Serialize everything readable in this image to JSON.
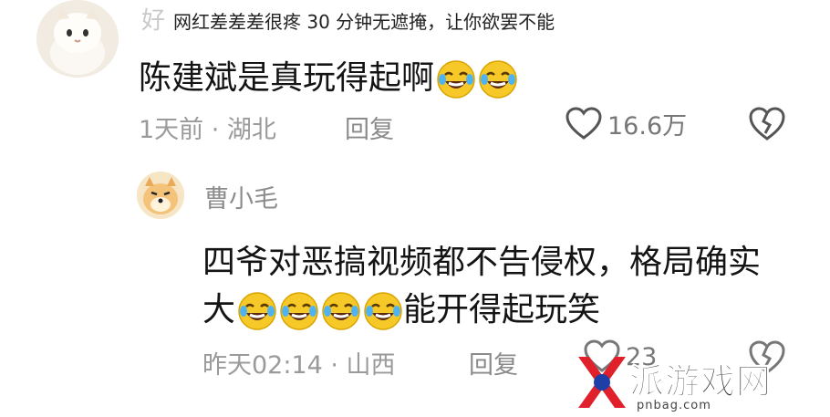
{
  "overlay_title": "网红差差差很疼 30 分钟无遮掩，让你欲罢不能",
  "comment": {
    "author_partial": "好",
    "text": "陈建斌是真玩得起啊",
    "time": "1天前 · 湖北",
    "reply_label": "回复",
    "likes": "16.6万"
  },
  "reply": {
    "author": "曹小毛",
    "line1": "四爷对恶搞视频都不告侵权，格局确实",
    "line2_prefix": "大",
    "line2_suffix": "能开得起玩笑",
    "time": "昨天02:14 · 山西",
    "reply_label": "回复",
    "likes": "23"
  },
  "watermark": {
    "text": "派游戏网",
    "url": "pnbag.com",
    "accent": "#e0202a"
  },
  "icons": [
    "laughing-crying-emoji",
    "heart-icon",
    "broken-heart-icon"
  ]
}
